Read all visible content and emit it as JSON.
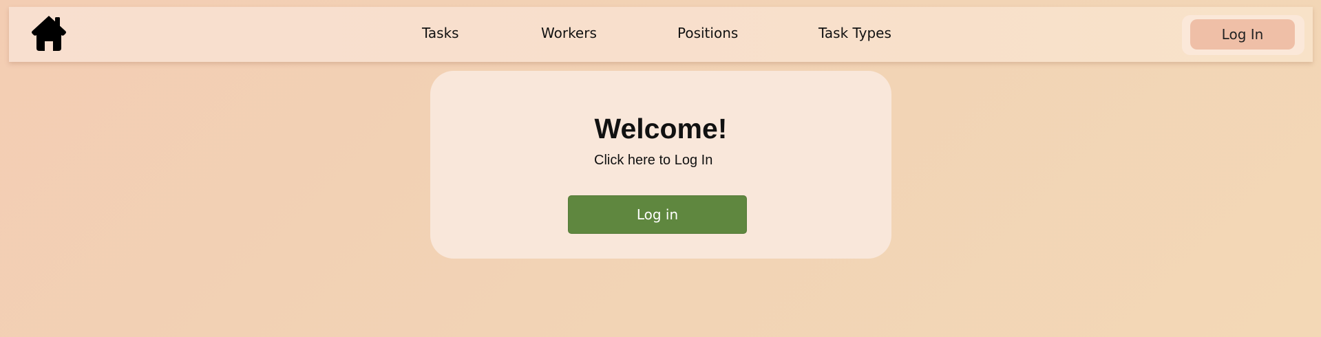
{
  "navbar": {
    "home_icon": "home-icon",
    "links": [
      {
        "label": "Tasks"
      },
      {
        "label": "Workers"
      },
      {
        "label": "Positions"
      },
      {
        "label": "Task Types"
      }
    ],
    "login_label": "Log In"
  },
  "main": {
    "heading": "Welcome!",
    "subtitle": "Click here to Log In",
    "button_label": "Log in"
  },
  "colors": {
    "page_background": "#f3cfb4",
    "navbar_background": "#f8dfcc",
    "card_background": "#f9e7da",
    "nav_login_button": "#efbfa7",
    "primary_button": "#5f873f"
  }
}
